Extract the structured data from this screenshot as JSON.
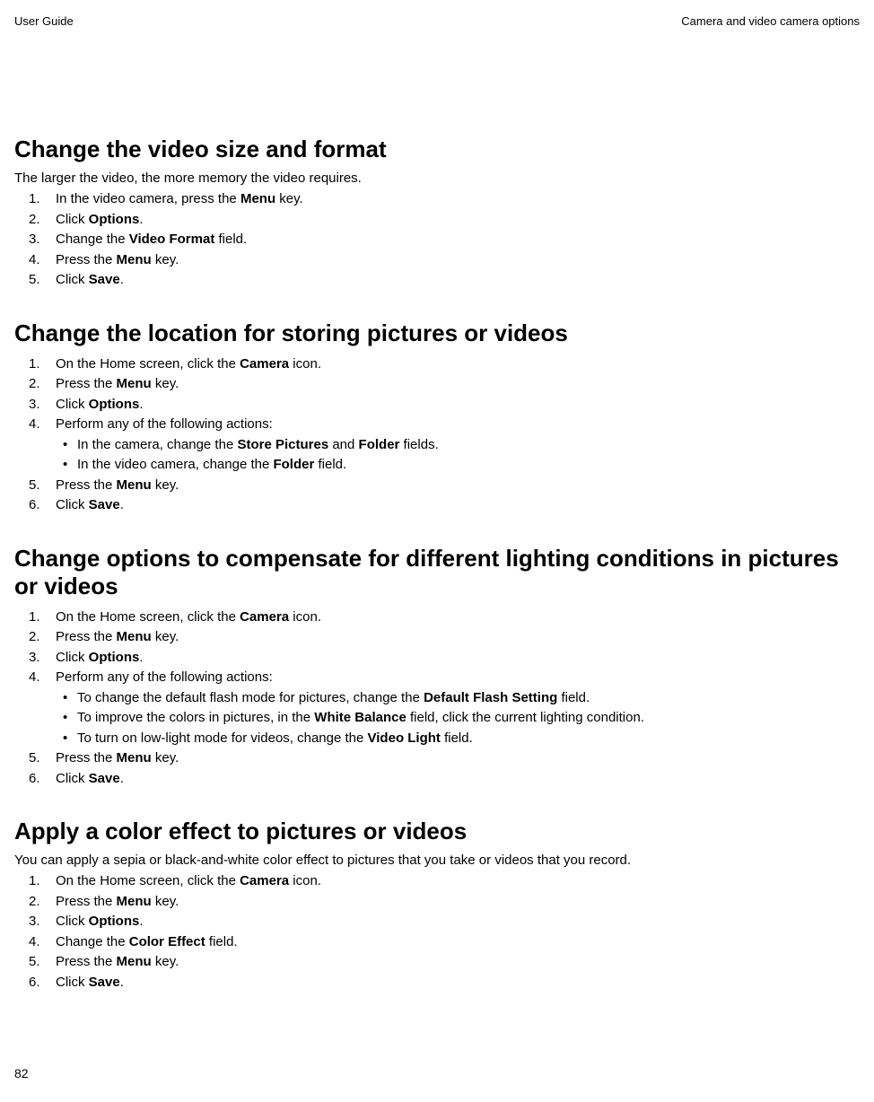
{
  "header": {
    "left": "User Guide",
    "right": "Camera and video camera options"
  },
  "page_number": "82",
  "sections": {
    "s1": {
      "title": "Change the video size and format",
      "intro": "The larger the video, the more memory the video requires.",
      "steps": {
        "1a": "In the video camera, press the ",
        "1b": "Menu",
        "1c": " key.",
        "2a": "Click ",
        "2b": "Options",
        "2c": ".",
        "3a": "Change the ",
        "3b": "Video Format",
        "3c": " field.",
        "4a": "Press the ",
        "4b": "Menu",
        "4c": " key.",
        "5a": "Click ",
        "5b": "Save",
        "5c": "."
      }
    },
    "s2": {
      "title": "Change the location for storing pictures or videos",
      "steps": {
        "1a": "On the Home screen, click the ",
        "1b": "Camera",
        "1c": " icon.",
        "2a": "Press the ",
        "2b": "Menu",
        "2c": " key.",
        "3a": "Click ",
        "3b": "Options",
        "3c": ".",
        "4a": "Perform any of the following actions:",
        "sub1a": "In the camera, change the ",
        "sub1b": "Store Pictures",
        "sub1c": " and ",
        "sub1d": "Folder",
        "sub1e": " fields.",
        "sub2a": "In the video camera, change the ",
        "sub2b": "Folder",
        "sub2c": " field.",
        "5a": "Press the ",
        "5b": "Menu",
        "5c": " key.",
        "6a": "Click ",
        "6b": "Save",
        "6c": "."
      }
    },
    "s3": {
      "title": "Change options to compensate for different lighting conditions in pictures or videos",
      "steps": {
        "1a": "On the Home screen, click the ",
        "1b": "Camera",
        "1c": " icon.",
        "2a": "Press the ",
        "2b": "Menu",
        "2c": " key.",
        "3a": "Click ",
        "3b": "Options",
        "3c": ".",
        "4a": "Perform any of the following actions:",
        "sub1a": "To change the default flash mode for pictures, change the ",
        "sub1b": "Default Flash Setting",
        "sub1c": " field.",
        "sub2a": "To improve the colors in pictures, in the ",
        "sub2b": "White Balance",
        "sub2c": " field, click the current lighting condition.",
        "sub3a": "To turn on low-light mode for videos, change the ",
        "sub3b": "Video Light",
        "sub3c": "  field.",
        "5a": "Press the ",
        "5b": "Menu",
        "5c": " key.",
        "6a": "Click ",
        "6b": "Save",
        "6c": "."
      }
    },
    "s4": {
      "title": "Apply a color effect to pictures or videos",
      "intro": "You can apply a sepia or black-and-white color effect to pictures that you take or videos that you record.",
      "steps": {
        "1a": "On the Home screen, click the ",
        "1b": "Camera",
        "1c": " icon.",
        "2a": "Press the ",
        "2b": "Menu",
        "2c": " key.",
        "3a": "Click ",
        "3b": "Options",
        "3c": ".",
        "4a": "Change the ",
        "4b": "Color Effect",
        "4c": " field.",
        "5a": "Press the ",
        "5b": "Menu",
        "5c": " key.",
        "6a": "Click ",
        "6b": "Save",
        "6c": "."
      }
    }
  }
}
